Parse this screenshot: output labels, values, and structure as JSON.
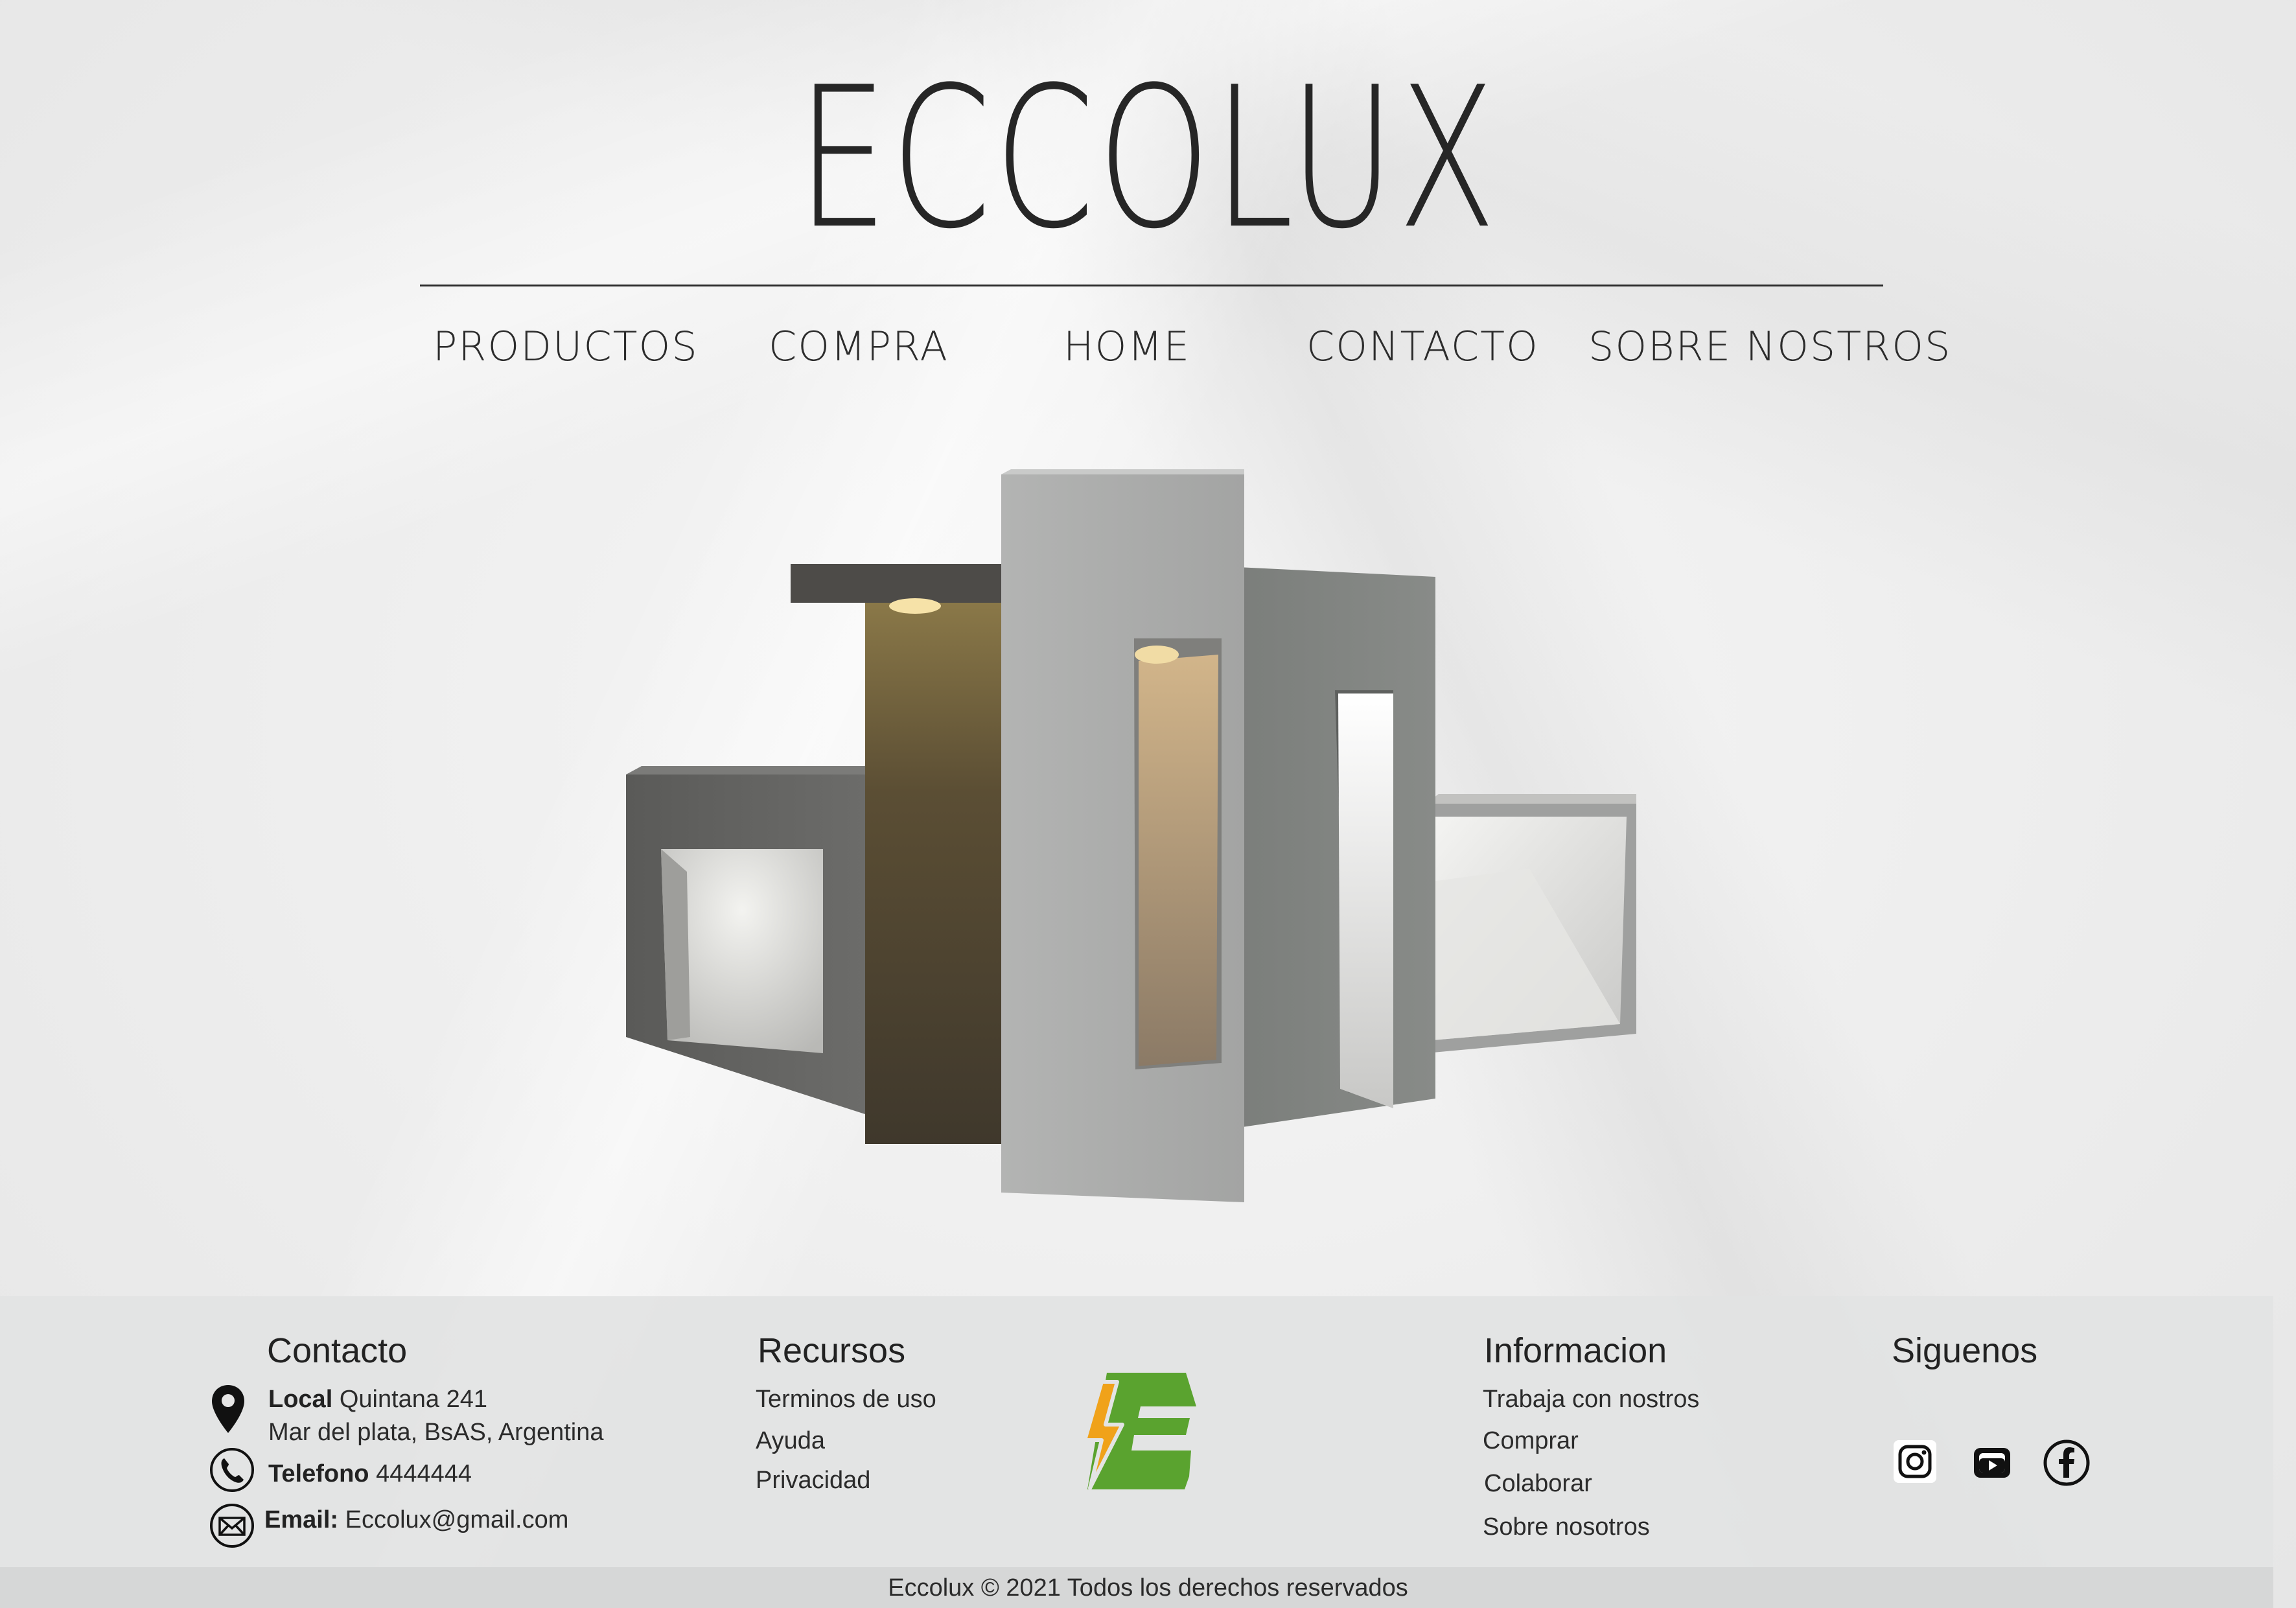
{
  "header": {
    "brand": "ECCOLUX",
    "nav": [
      "PRODUCTOS",
      "COMPRA",
      "HOME",
      "CONTACTO",
      "SOBRE NOSTROS"
    ]
  },
  "hero": {
    "image_subject": "Concrete outdoor bollard lights"
  },
  "footer": {
    "contacto": {
      "title": "Contacto",
      "local_label": "Local",
      "local_value": "Quintana 241",
      "address_line2": "Mar del plata, BsAS, Argentina",
      "phone_label": "Telefono",
      "phone_value": "4444444",
      "email_label": "Email:",
      "email_value": "Eccolux@gmail.com"
    },
    "recursos": {
      "title": "Recursos",
      "links": [
        "Terminos de uso",
        "Ayuda",
        "Privacidad"
      ]
    },
    "informacion": {
      "title": "Informacion",
      "links": [
        "Trabaja con nostros",
        "Comprar",
        "Colaborar",
        "Sobre nosotros"
      ]
    },
    "siguenos": {
      "title": "Siguenos",
      "networks": [
        "instagram",
        "youtube",
        "facebook"
      ]
    },
    "logo_colors": {
      "green": "#5aa32f",
      "orange": "#f0a21a"
    },
    "copyright": "Eccolux © 2021 Todos los derechos reservados"
  }
}
